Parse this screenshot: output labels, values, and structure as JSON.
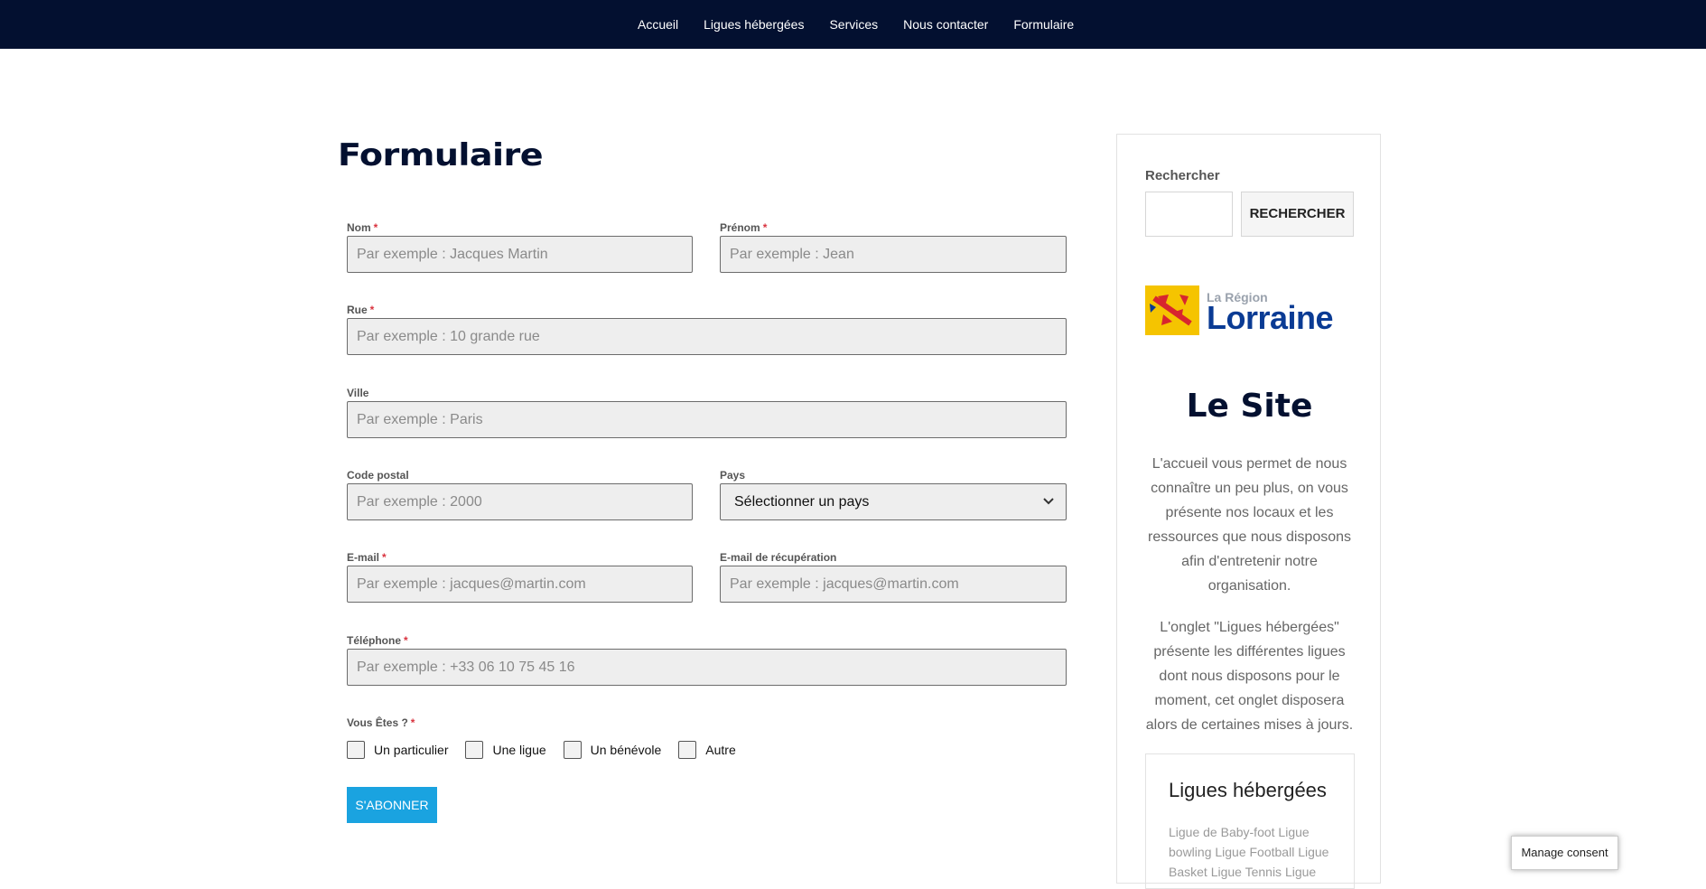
{
  "nav": {
    "items": [
      "Accueil",
      "Ligues hébergées",
      "Services",
      "Nous contacter",
      "Formulaire"
    ]
  },
  "page": {
    "title": "Formulaire"
  },
  "form": {
    "nom": {
      "label": "Nom",
      "required": "*",
      "placeholder": "Par exemple : Jacques Martin"
    },
    "prenom": {
      "label": "Prénom",
      "required": "*",
      "placeholder": "Par exemple : Jean"
    },
    "rue": {
      "label": "Rue",
      "required": "*",
      "placeholder": "Par exemple : 10 grande rue"
    },
    "ville": {
      "label": "Ville",
      "placeholder": "Par exemple : Paris"
    },
    "code_postal": {
      "label": "Code postal",
      "placeholder": "Par exemple : 2000"
    },
    "pays": {
      "label": "Pays",
      "value": "Sélectionner un pays"
    },
    "email": {
      "label": "E-mail",
      "required": "*",
      "placeholder": "Par exemple : jacques@martin.com"
    },
    "email_recup": {
      "label": "E-mail de récupération",
      "placeholder": "Par exemple : jacques@martin.com"
    },
    "telephone": {
      "label": "Téléphone",
      "required": "*",
      "placeholder": "Par exemple : +33 06 10 75 45 16"
    },
    "vous_etes": {
      "label": "Vous Êtes ?",
      "required": "*",
      "options": [
        "Un particulier",
        "Une ligue",
        "Un bénévole",
        "Autre"
      ]
    },
    "submit_label": "S'ABONNER"
  },
  "sidebar": {
    "search_label": "Rechercher",
    "search_button": "RECHERCHER",
    "logo_sub": "La Région",
    "logo_main": "Lorraine",
    "site_title": "Le Site",
    "paragraph1": "L'accueil vous permet de nous connaître un peu plus, on vous présente nos locaux et les ressources que nous disposons afin d'entretenir notre organisation.",
    "paragraph2": "L'onglet \"Ligues hébergées\" présente les différentes ligues dont nous disposons pour le moment, cet onglet disposera alors de certaines mises à jours.",
    "ligues_title": "Ligues hébergées",
    "ligues_list": "Ligue de Baby-foot Ligue bowling Ligue Football Ligue Basket Ligue Tennis Ligue"
  },
  "consent_button": "Manage consent",
  "colors": {
    "nav_bg": "#031030",
    "accent": "#1aa3e0",
    "required": "#d9333f",
    "logo_blue": "#0a3b94",
    "logo_yellow": "#f5c400"
  }
}
